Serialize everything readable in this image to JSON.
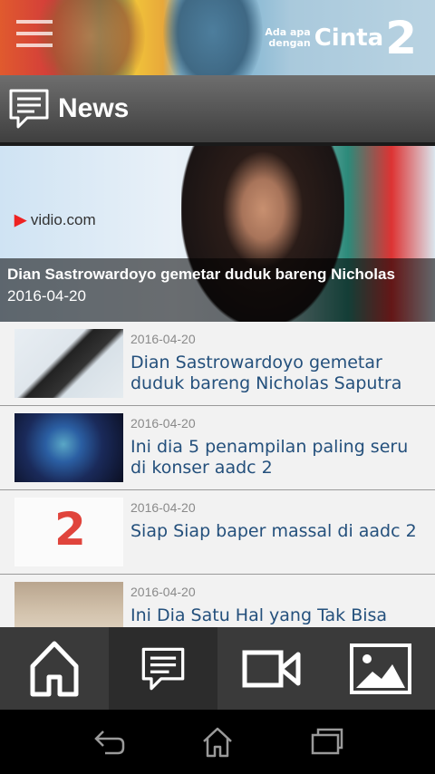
{
  "banner": {
    "logo_small_line1": "Ada apa",
    "logo_small_line2": "dengan",
    "logo_big": "Cinta",
    "logo_number": "2"
  },
  "section": {
    "title": "News"
  },
  "featured": {
    "title": "Dian Sastrowardoyo gemetar duduk bareng Nicholas",
    "date": "2016-04-20",
    "image_brand": "vidio.com"
  },
  "news": [
    {
      "date": "2016-04-20",
      "title": "Dian Sastrowardoyo gemetar duduk bareng Nicholas Saputra"
    },
    {
      "date": "2016-04-20",
      "title": "Ini dia 5 penampilan paling seru di konser aadc 2"
    },
    {
      "date": "2016-04-20",
      "title": "Siap Siap baper massal di aadc 2"
    },
    {
      "date": "2016-04-20",
      "title": "Ini Dia Satu Hal yang Tak Bisa"
    }
  ],
  "bottom_nav": [
    {
      "icon": "home-icon",
      "active": false
    },
    {
      "icon": "news-icon",
      "active": true
    },
    {
      "icon": "video-icon",
      "active": false
    },
    {
      "icon": "gallery-icon",
      "active": false
    }
  ],
  "system_nav": [
    "back-icon",
    "home-icon",
    "recents-icon"
  ],
  "colors": {
    "headline_blue": "#24507c",
    "date_gray": "#8a8a8a",
    "nav_bg": "#3a3a3a"
  }
}
